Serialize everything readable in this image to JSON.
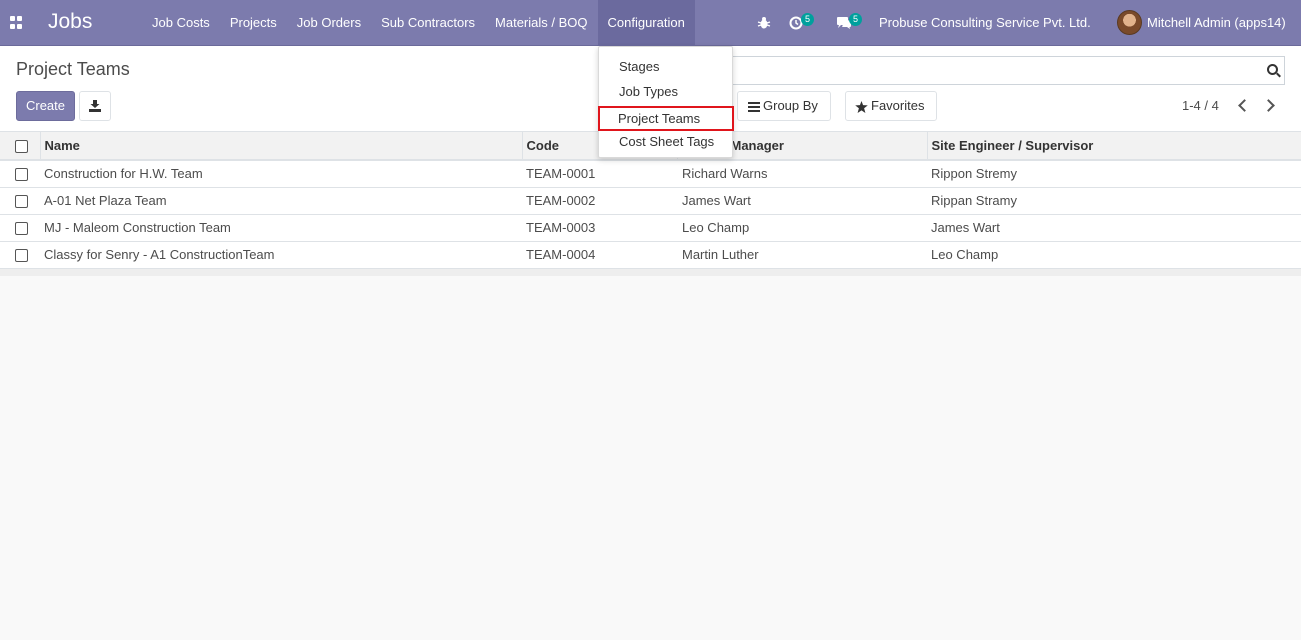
{
  "navbar": {
    "brand": "Jobs",
    "menu": [
      "Job Costs",
      "Projects",
      "Job Orders",
      "Sub Contractors",
      "Materials / BOQ",
      "Configuration"
    ],
    "activity_count": "5",
    "messages_count": "5",
    "company": "Probuse Consulting Service Pvt. Ltd.",
    "user": "Mitchell Admin (apps14)"
  },
  "config_dropdown": {
    "items": [
      "Stages",
      "Job Types",
      "Project Teams",
      "Cost Sheet Tags"
    ]
  },
  "control_panel": {
    "title": "Project Teams",
    "create_label": "Create",
    "group_by_label": "Group By",
    "favorites_label": "Favorites",
    "pager": "1-4 / 4"
  },
  "table": {
    "headers": [
      "Name",
      "Code",
      "Manager",
      "Site Engineer / Supervisor"
    ],
    "rows": [
      {
        "name": "Construction for H.W. Team",
        "code": "TEAM-0001",
        "manager": "Richard Warns",
        "engineer": "Rippon Stremy"
      },
      {
        "name": "A-01 Net Plaza Team",
        "code": "TEAM-0002",
        "manager": "James Wart",
        "engineer": "Rippan Stramy"
      },
      {
        "name": "MJ - Maleom Construction Team",
        "code": "TEAM-0003",
        "manager": "Leo Champ",
        "engineer": "James Wart"
      },
      {
        "name": "Classy for Senry - A1 ConstructionTeam",
        "code": "TEAM-0004",
        "manager": "Martin Luther",
        "engineer": "Leo Champ"
      }
    ]
  },
  "colors": {
    "brand": "#7c7bad",
    "badge": "#00a09d",
    "highlight": "#e0151c"
  }
}
